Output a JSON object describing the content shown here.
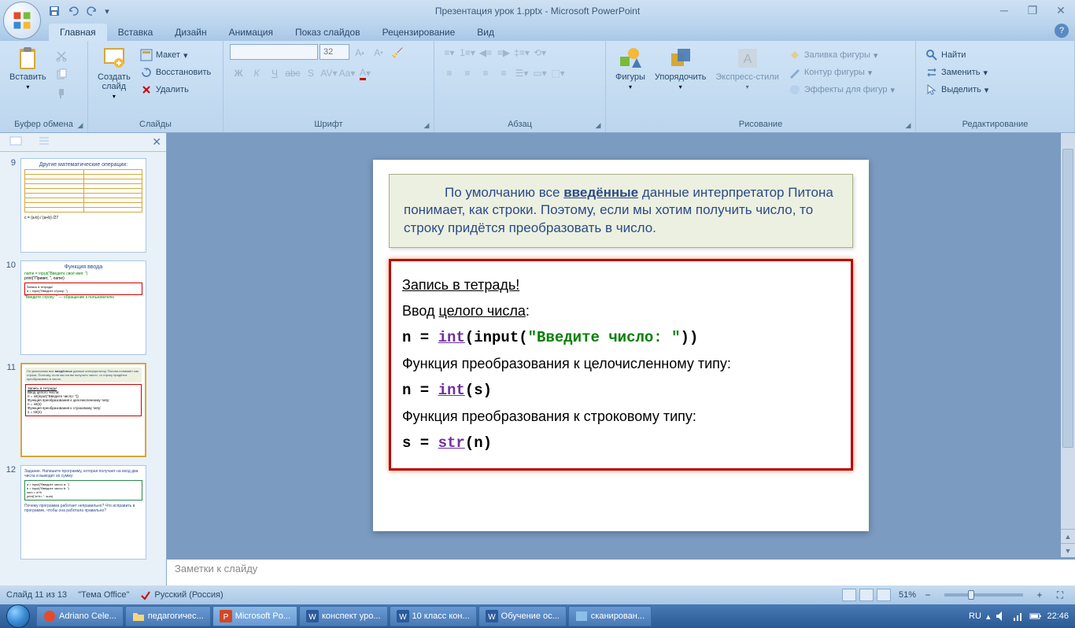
{
  "app": {
    "title": "Презентация урок 1.pptx - Microsoft PowerPoint"
  },
  "tabs": {
    "home": "Главная",
    "insert": "Вставка",
    "design": "Дизайн",
    "animation": "Анимация",
    "slideshow": "Показ слайдов",
    "review": "Рецензирование",
    "view": "Вид"
  },
  "ribbon": {
    "clipboard": {
      "label": "Буфер обмена",
      "paste": "Вставить"
    },
    "slides": {
      "label": "Слайды",
      "new": "Создать\nслайд",
      "layout": "Макет",
      "reset": "Восстановить",
      "delete": "Удалить"
    },
    "font": {
      "label": "Шрифт",
      "size": "32"
    },
    "paragraph": {
      "label": "Абзац"
    },
    "drawing": {
      "label": "Рисование",
      "shapes": "Фигуры",
      "arrange": "Упорядочить",
      "quickstyles": "Экспресс-стили",
      "fill": "Заливка фигуры",
      "outline": "Контур фигуры",
      "effects": "Эффекты для фигур"
    },
    "editing": {
      "label": "Редактирование",
      "find": "Найти",
      "replace": "Заменить",
      "select": "Выделить"
    }
  },
  "thumbs": {
    "n9": "9",
    "n10": "10",
    "n11": "11",
    "n12": "12",
    "t9_title": "Другие математические операции:",
    "t10_title": "Функция ввода",
    "t12_title": "Задание. Напишите программу, которая получает на вход два числа и выводит их сумму:"
  },
  "slide": {
    "intro1": "По умолчанию все ",
    "intro_bold": "введённые",
    "intro2": " данные интерпретатор Питона понимает, как строки. Поэтому, если мы хотим получить число, то строку придётся преобразовать в число.",
    "heading": "Запись в тетрадь!",
    "line1": "Ввод ",
    "line1_u": "целого числа",
    "line1_end": ":",
    "code1_a": "n = ",
    "code1_kw": "int",
    "code1_b": "(input(",
    "code1_str": "\"Введите число: \"",
    "code1_c": "))",
    "line2": "Функция преобразования к целочисленному типу:",
    "code2_a": "n = ",
    "code2_kw": "int",
    "code2_b": "(s)",
    "line3": "Функция преобразования к строковому типу:",
    "code3_a": "s = ",
    "code3_kw": "str",
    "code3_b": "(n)"
  },
  "notes": {
    "placeholder": "Заметки к слайду"
  },
  "status": {
    "slide": "Слайд 11 из 13",
    "theme": "\"Тема Office\"",
    "lang": "Русский (Россия)",
    "zoom": "51%"
  },
  "taskbar": {
    "t1": "Adriano Cele...",
    "t2": "педагогичес...",
    "t3": "Microsoft Po...",
    "t4": "конспект уро...",
    "t5": "10 класс кон...",
    "t6": "Обучение ос...",
    "t7": "сканирован...",
    "lang": "RU",
    "time": "22:46"
  }
}
